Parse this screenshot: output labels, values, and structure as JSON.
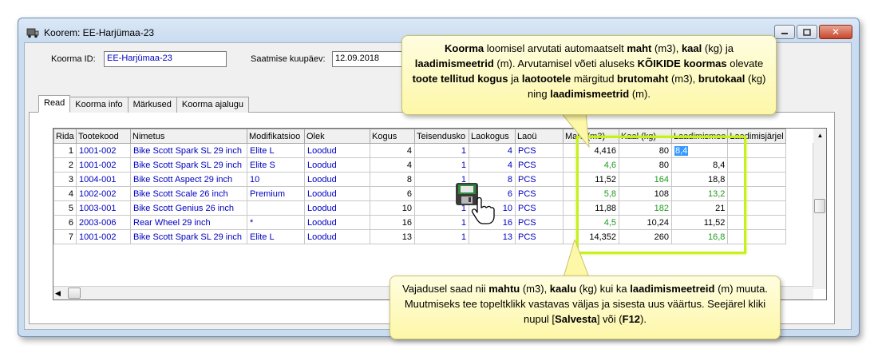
{
  "window": {
    "title": "Koorem: EE-Harjümaa-23"
  },
  "form": {
    "id_label": "Koorma ID:",
    "id_value": "EE-Harjümaa-23",
    "date_label": "Saatmise kuupäev:",
    "date_value": "12.09.2018"
  },
  "tabs": [
    "Read",
    "Koorma info",
    "Märkused",
    "Koorma ajalugu"
  ],
  "table": {
    "columns": [
      "Rida",
      "Tootekood",
      "Nimetus",
      "Modifikatsioo",
      "Olek",
      "Kogus",
      "Teisendusko",
      "Laokogus",
      "Laoü",
      "Maht (m3)",
      "Kaal (kg)",
      "Laadimismee",
      "Laadimisjärjel"
    ],
    "rows": [
      [
        "1",
        "1001-002",
        "Bike Scott Spark SL 29 inch",
        "Elite L",
        "Loodud",
        "4",
        "1",
        "4",
        "PCS",
        "4,416",
        "80",
        "8,4",
        ""
      ],
      [
        "2",
        "1001-002",
        "Bike Scott Spark SL 29 inch",
        "Elite S",
        "Loodud",
        "4",
        "1",
        "4",
        "PCS",
        "4,6",
        "80",
        "8,4",
        ""
      ],
      [
        "3",
        "1004-001",
        "Bike Scott Aspect 29 inch",
        "10",
        "Loodud",
        "8",
        "1",
        "8",
        "PCS",
        "11,52",
        "164",
        "18,8",
        ""
      ],
      [
        "4",
        "1002-002",
        "Bike Scott Scale 26 inch",
        "Premium",
        "Loodud",
        "6",
        "1",
        "6",
        "PCS",
        "5,8",
        "108",
        "13,2",
        ""
      ],
      [
        "5",
        "1003-001",
        "Bike Scott Genius 26 inch",
        "",
        "Loodud",
        "10",
        "1",
        "10",
        "PCS",
        "11,88",
        "182",
        "21",
        ""
      ],
      [
        "6",
        "2003-006",
        "Rear Wheel 29 inch",
        "*",
        "Loodud",
        "16",
        "1",
        "16",
        "PCS",
        "4,5",
        "10,24",
        "11,52",
        ""
      ],
      [
        "7",
        "1001-002",
        "Bike Scott Spark SL 29 inch",
        "Elite L",
        "Loodud",
        "13",
        "1",
        "13",
        "PCS",
        "14,352",
        "260",
        "16,8",
        ""
      ]
    ]
  },
  "callout_top": {
    "p1": "Koorma",
    "p2": " loomisel arvutati automaatselt ",
    "p3": "maht",
    "p4": " (m3), ",
    "p5": "kaal",
    "p6": " (kg) ja ",
    "p7": "laadimismeetrid",
    "p8": " (m). Arvutamisel võeti aluseks ",
    "p9": "KÕIKIDE koormas",
    "p10": " olevate ",
    "p11": "toote tellitud kogus",
    "p12": " ja ",
    "p13": "laotootele",
    "p14": " märgitud ",
    "p15": "brutomaht",
    "p16": " (m3), ",
    "p17": "brutokaal",
    "p18": " (kg) ning ",
    "p19": "laadimismeetrid",
    "p20": " (m)."
  },
  "callout_bottom": {
    "p1": "Vajadusel saad nii ",
    "p2": "mahtu",
    "p3": " (m3), ",
    "p4": "kaalu",
    "p5": " (kg) kui ka ",
    "p6": "laadimismeetreid",
    "p7": " (m) muuta. Muutmiseks tee topeltklikk vastavas väljas ja sisesta uus väärtus. Seejärel kliki nupul [",
    "p8": "Salvesta",
    "p9": "] või (",
    "p10": "F12",
    "p11": ")."
  },
  "icons": {
    "app": "truck-icon",
    "save": "floppy-disk-icon",
    "cursor": "hand-pointer-icon"
  },
  "colors": {
    "highlight": "#c8f01e",
    "link_text": "#0000c0",
    "green_value": "#1f9b1f",
    "callout_bg": "#fdf7a8"
  }
}
